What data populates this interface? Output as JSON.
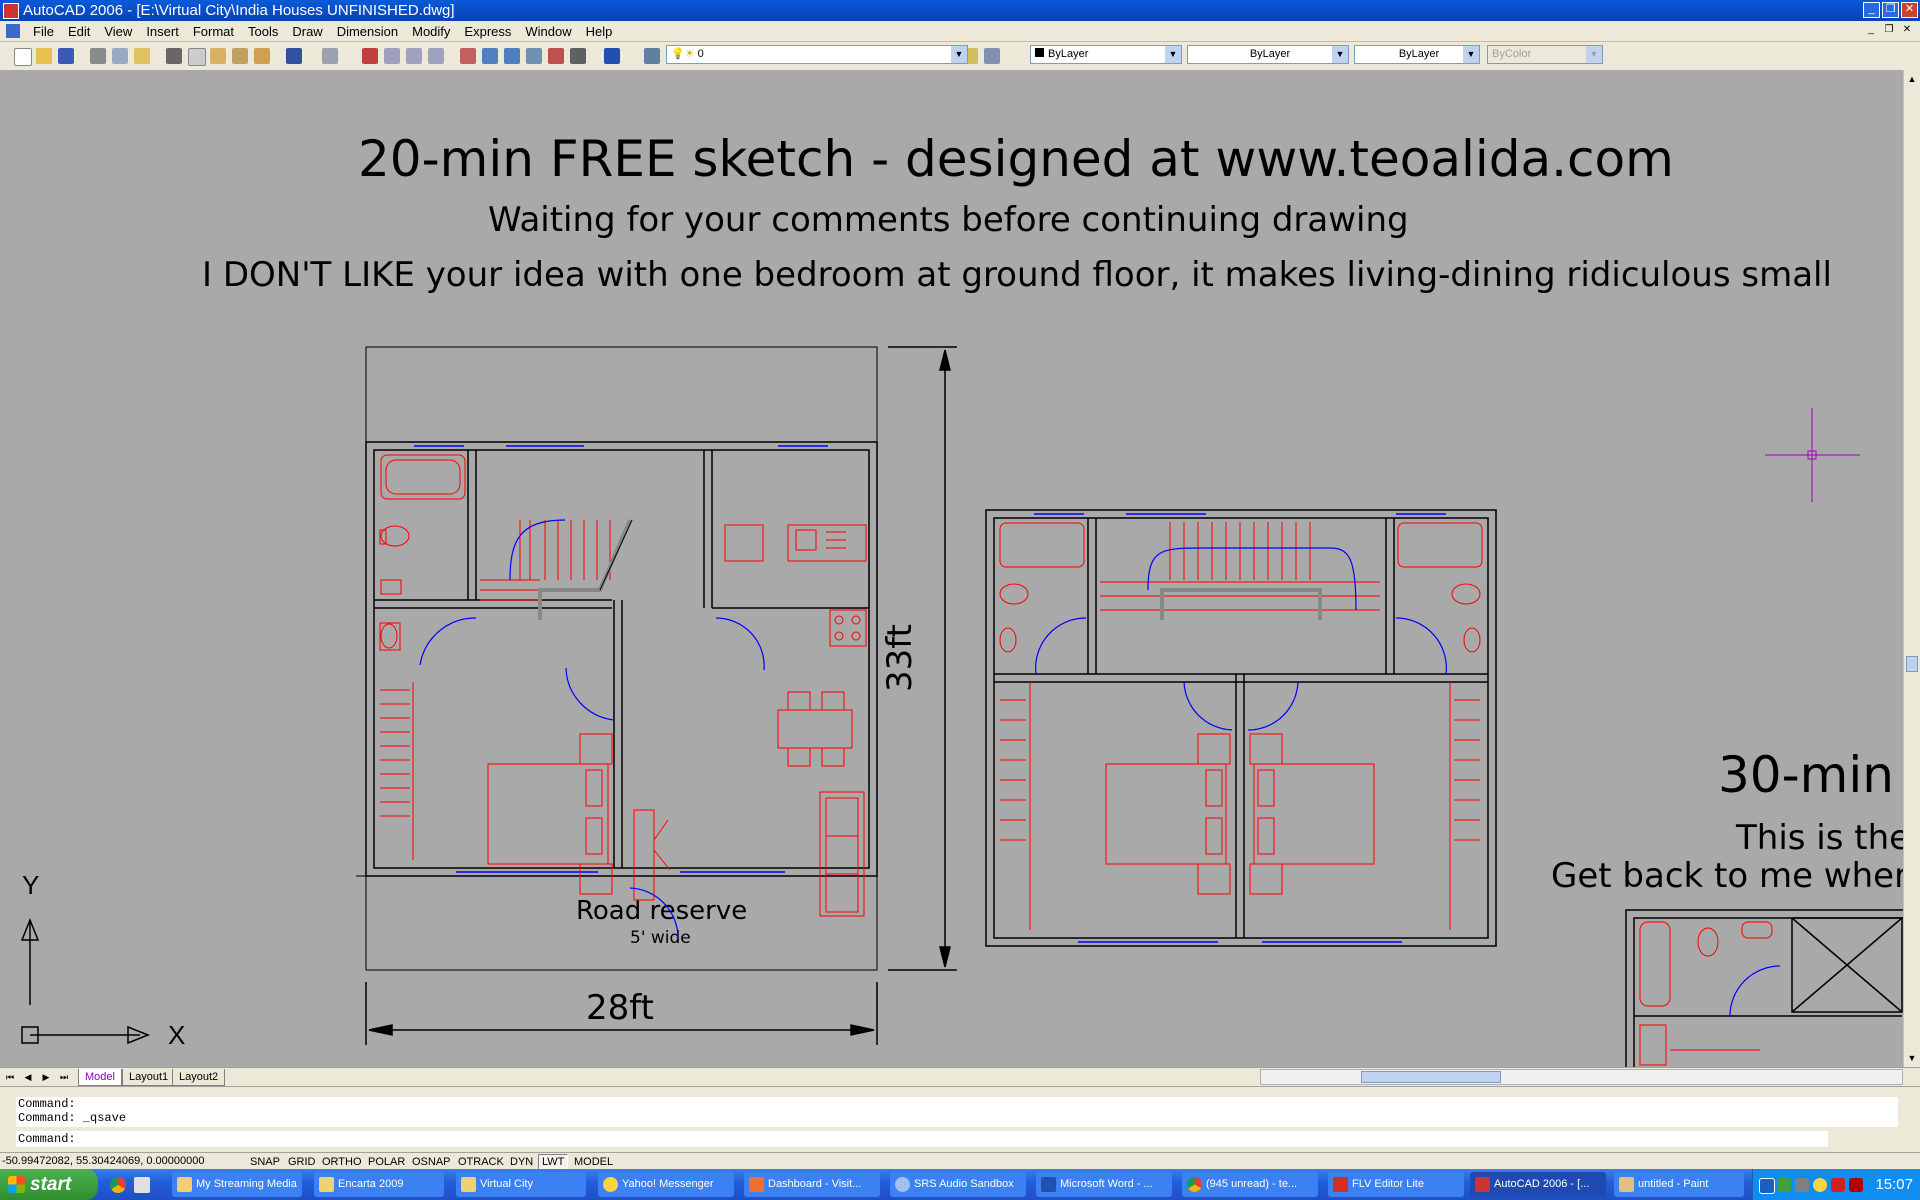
{
  "window": {
    "title": "AutoCAD 2006 - [E:\\Virtual City\\India Houses UNFINISHED.dwg]"
  },
  "menu": [
    "File",
    "Edit",
    "View",
    "Insert",
    "Format",
    "Tools",
    "Draw",
    "Dimension",
    "Modify",
    "Express",
    "Window",
    "Help"
  ],
  "toolbar": {
    "layer_value": "0",
    "color_value": "ByLayer",
    "linetype_value": "ByLayer",
    "lineweight_value": "ByLayer",
    "plotstyle_value": "ByColor"
  },
  "drawing": {
    "heading": "20-min FREE sketch - designed at www.teoalida.com",
    "subheading": "Waiting for your comments before continuing drawing",
    "note": "I DON'T LIKE your idea with one bedroom at ground floor, it makes living-dining ridiculous small",
    "road_label": "Road reserve",
    "road_width": "5' wide",
    "dim_width": "28ft",
    "dim_depth": "33ft",
    "second_heading": "30-min",
    "second_line1": "This is the",
    "second_line2": "Get back to me when",
    "ucs_y": "Y",
    "ucs_x": "X"
  },
  "layout_tabs": [
    "Model",
    "Layout1",
    "Layout2"
  ],
  "command": {
    "history": [
      "Command:",
      "Command: _qsave"
    ],
    "prompt": "Command:"
  },
  "status": {
    "coords": "-50.99472082, 55.30424069, 0.00000000",
    "buttons": [
      "SNAP",
      "GRID",
      "ORTHO",
      "POLAR",
      "OSNAP",
      "OTRACK",
      "DYN",
      "LWT",
      "MODEL"
    ]
  },
  "taskbar": {
    "start": "start",
    "tasks": [
      "My Streaming Media",
      "Encarta 2009",
      "Virtual City",
      "Yahoo! Messenger",
      "Dashboard - Visit...",
      "SRS Audio Sandbox",
      "Microsoft Word - ...",
      "(945 unread) - te...",
      "FLV Editor Lite",
      "AutoCAD 2006 - [...",
      "untitled - Paint"
    ],
    "clock": "15:07"
  },
  "colors": {
    "canvas": "#a9a9a9",
    "wall": "#000000",
    "furniture": "#ff0000",
    "door": "#0000ff",
    "crosshair": "#a000c0"
  }
}
